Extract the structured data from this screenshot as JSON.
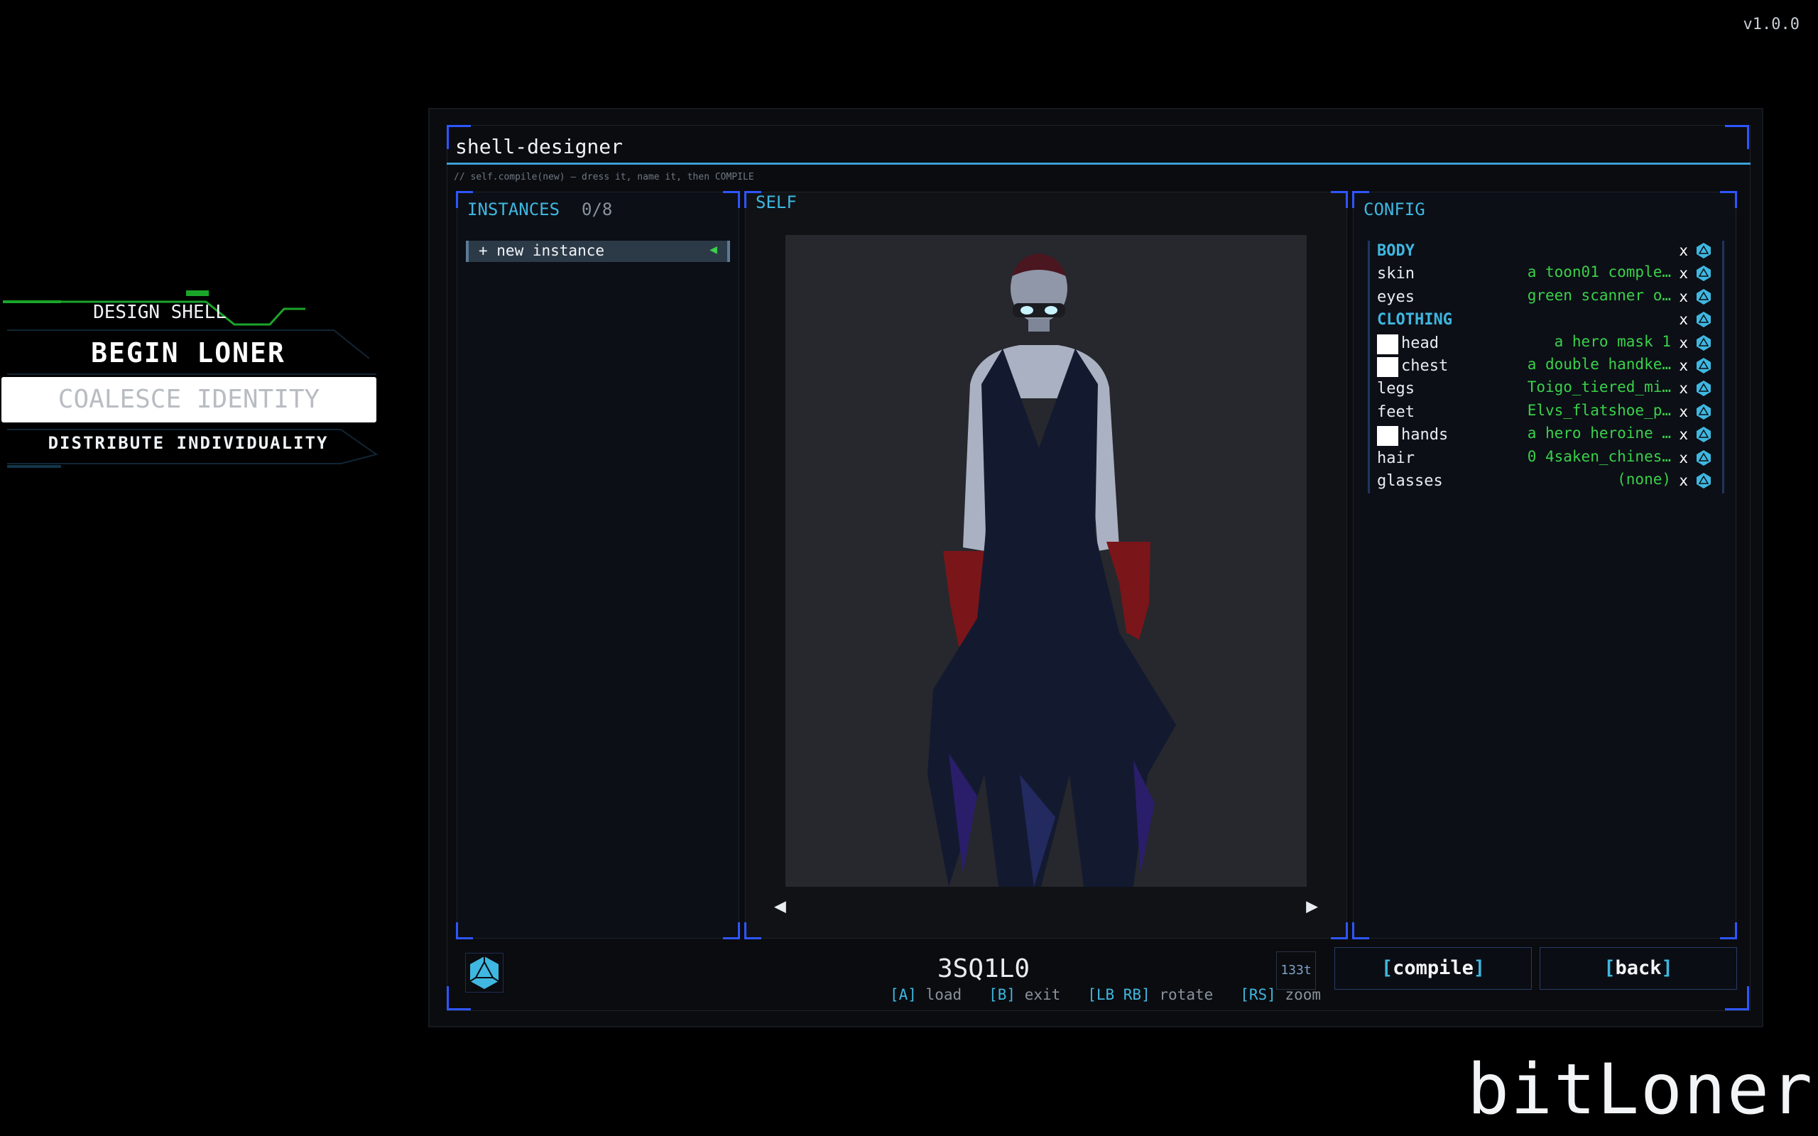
{
  "version": "v1.0.0",
  "brand": "bitLoner",
  "menu": {
    "design_shell": "DESIGN SHELL",
    "begin_loner": "BEGIN LONER",
    "coalesce_identity": "COALESCE IDENTITY",
    "distribute_individuality": "DISTRIBUTE INDIVIDUALITY"
  },
  "window": {
    "title": "shell-designer",
    "hint": "// self.compile(new) — dress it, name it, then COMPILE"
  },
  "instances": {
    "title": "INSTANCES",
    "count": "0/8",
    "new_instance": "+ new instance",
    "arrow": "◀"
  },
  "self": {
    "title": "SELF",
    "prev": "◀",
    "next": "▶"
  },
  "config": {
    "title": "CONFIG",
    "body_section": "BODY",
    "clothing_section": "CLOTHING",
    "x": "x",
    "rows": {
      "skin": {
        "label": "skin",
        "value": "a toon01 comple…"
      },
      "eyes": {
        "label": "eyes",
        "value": "green scanner o…"
      },
      "head": {
        "label": "head",
        "value": "a hero mask 1"
      },
      "chest": {
        "label": "chest",
        "value": "a double handke…"
      },
      "legs": {
        "label": "legs",
        "value": "Toigo_tiered_mi…"
      },
      "feet": {
        "label": "feet",
        "value": "Elvs_flatshoe_p…"
      },
      "hands": {
        "label": "hands",
        "value": "a hero heroine …"
      },
      "hair": {
        "label": "hair",
        "value": "0 4saken_chines…"
      },
      "glasses": {
        "label": "glasses",
        "value": "(none)"
      }
    }
  },
  "bottom": {
    "shell_name": "3SQ1L0",
    "ticks": "133t",
    "controls": [
      {
        "key": "[A]",
        "label": "load"
      },
      {
        "key": "[B]",
        "label": "exit"
      },
      {
        "key": "[LB RB]",
        "label": "rotate"
      },
      {
        "key": "[RS]",
        "label": "zoom"
      }
    ],
    "compile": "compile",
    "back": "back",
    "bracket_open": "[",
    "bracket_close": "]"
  },
  "colors": {
    "accent": "#3fb7e0",
    "frame": "#2f56ff",
    "value_green": "#3ad14a",
    "bg": "#000000"
  }
}
